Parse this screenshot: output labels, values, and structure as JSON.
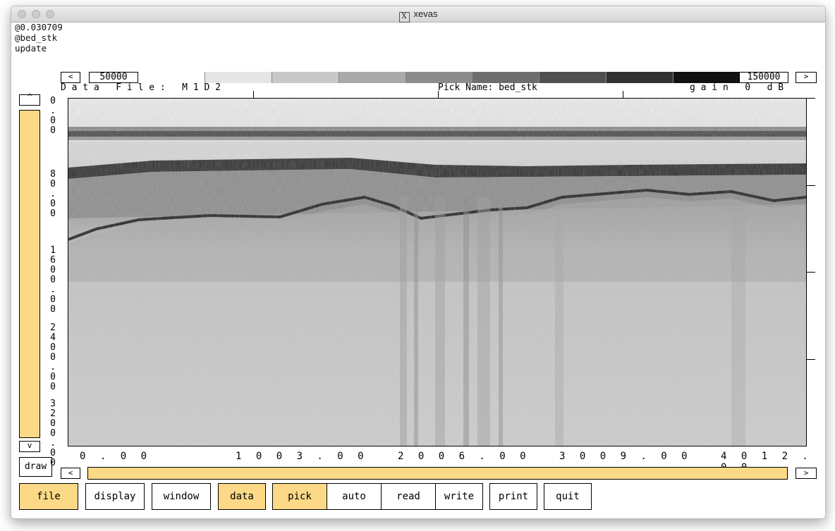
{
  "window": {
    "title": "xevas"
  },
  "context_lines": [
    "@0.030709",
    "@bed_stk",
    "update"
  ],
  "colors": {
    "accent": "#fcd986"
  },
  "scale": {
    "left_arrow": "<",
    "right_arrow": ">",
    "min_value": "50000",
    "max_value": "150000"
  },
  "info": {
    "data_file_label": "D a t a   F i l e :   M 1 D 2",
    "pick_name_label": "Pick Name: bed_stk",
    "gain_label": "g a i n   0   d B"
  },
  "y_axis": {
    "scroll_up": "^",
    "scroll_down": "v",
    "labels": [
      "0\n.\n0\n0",
      "8\n0\n.\n0\n0",
      "1\n6\n0\n0\n.\n0\n0",
      "2\n4\n0\n0\n.\n0\n0",
      "3\n2\n0\n0\n.\n0\n0"
    ]
  },
  "x_axis": {
    "labels": [
      "0 . 0 0",
      "1 0 0 3 . 0 0",
      "2 0 0 6 . 0 0",
      "3 0 0 9 . 0 0",
      "4 0 1 2 . 0 0"
    ]
  },
  "draw_button": "draw",
  "hscroll": {
    "left_arrow": "<",
    "right_arrow": ">"
  },
  "menu": {
    "file": "file",
    "display": "display",
    "window": "window",
    "data": "data",
    "pick": "pick",
    "auto": "auto",
    "read": "read",
    "write": "write",
    "print": "print",
    "quit": "quit"
  }
}
